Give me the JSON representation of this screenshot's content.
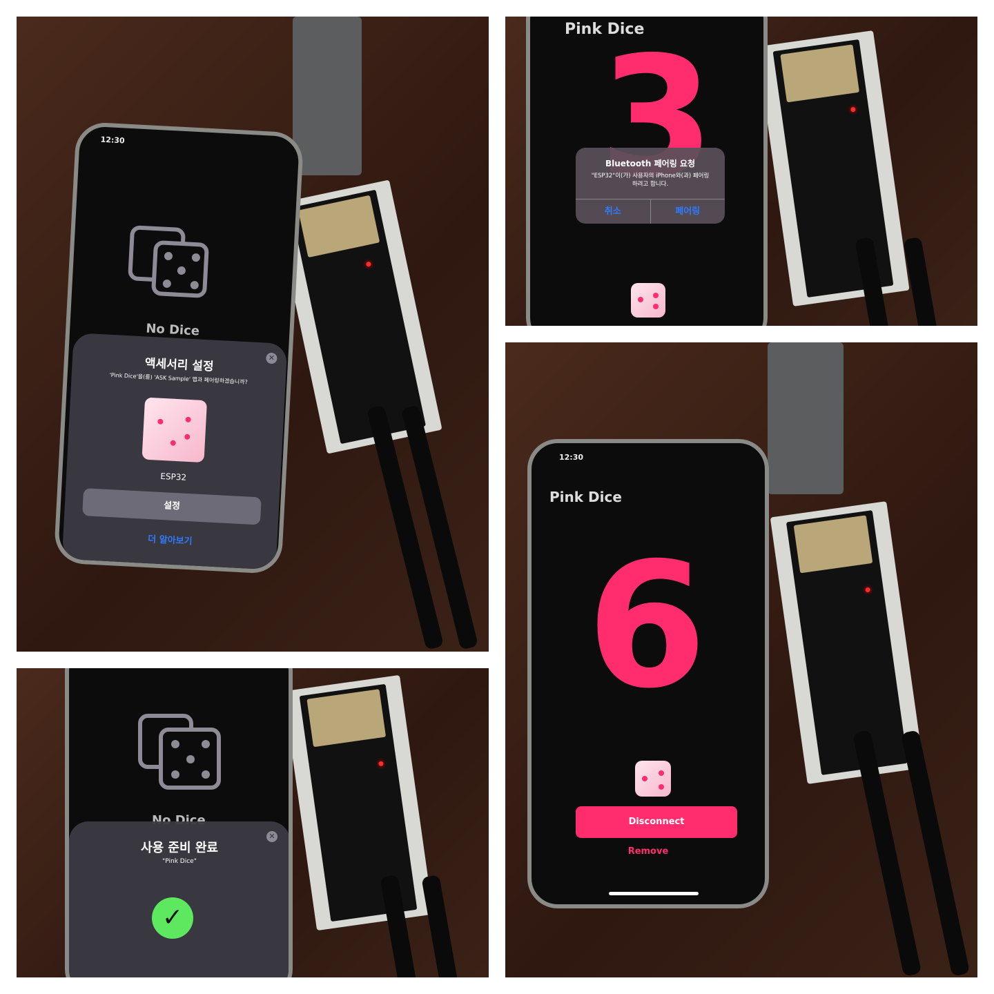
{
  "panel1": {
    "status_time": "12:30",
    "no_dice_label": "No Dice",
    "sheet_title": "액세서리 설정",
    "sheet_subtitle": "'Pink Dice'을(를) 'ASK Sample' 앱과 페어링하겠습니까?",
    "device_name": "ESP32",
    "setup_button": "설정",
    "learn_more_link": "더 알아보기"
  },
  "panel2": {
    "app_title_partial": "Pink Dice",
    "dice_number": "3",
    "alert_title": "Bluetooth 페어링 요청",
    "alert_message": "\"ESP32\"이(가) 사용자의 iPhone와(과) 페어링하려고 합니다.",
    "cancel_button": "취소",
    "pair_button": "페어링"
  },
  "panel3": {
    "no_dice_label": "No Dice",
    "sheet_title": "사용 준비 완료",
    "sheet_subtitle": "\"Pink Dice\""
  },
  "panel4": {
    "status_time": "12:30",
    "app_title": "Pink Dice",
    "dice_number": "6",
    "disconnect_button": "Disconnect",
    "remove_button": "Remove"
  },
  "colors": {
    "accent_pink": "#ff2d6e",
    "link_blue": "#2f7bff",
    "success_green": "#5ee860"
  }
}
